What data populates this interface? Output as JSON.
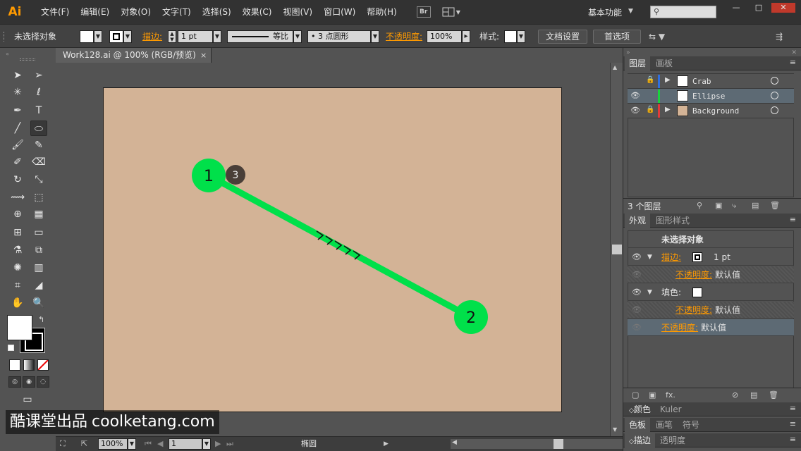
{
  "menubar": {
    "logo": "Ai",
    "items": [
      "文件(F)",
      "编辑(E)",
      "对象(O)",
      "文字(T)",
      "选择(S)",
      "效果(C)",
      "视图(V)",
      "窗口(W)",
      "帮助(H)"
    ],
    "bridge_label": "Br",
    "workspace": "基本功能",
    "window_controls": [
      "—",
      "□",
      "✕"
    ]
  },
  "controlbar": {
    "selection_label": "未选择对象",
    "stroke_label": "描边:",
    "stroke_weight": "1 pt",
    "stroke_profile": "等比",
    "brush_label": "3 点圆形",
    "opacity_label": "不透明度:",
    "opacity_value": "100%",
    "style_label": "样式:",
    "doc_setup_btn": "文档设置",
    "prefs_btn": "首选项"
  },
  "document": {
    "tab_title": "Work128.ai @ 100% (RGB/预览)",
    "tab_close": "×",
    "artboard_color": "#d3b396",
    "steps": [
      {
        "label": "1"
      },
      {
        "label": "3"
      },
      {
        "label": "2"
      }
    ],
    "path_color": "#00e04a",
    "step_marker_color": "#4a3f38"
  },
  "statusbar": {
    "zoom": "100%",
    "artboard_num": "1",
    "tool_name": "椭圆"
  },
  "layers_panel": {
    "tabs": [
      "图层",
      "画板"
    ],
    "layers": [
      {
        "name": "Crab",
        "color": "#2f6fe0",
        "locked": true,
        "visible": false,
        "expandable": true
      },
      {
        "name": "Ellipse",
        "color": "#19d23c",
        "locked": false,
        "visible": true,
        "expandable": false,
        "selected": true
      },
      {
        "name": "Background",
        "color": "#e03a3a",
        "locked": true,
        "visible": true,
        "expandable": true
      }
    ],
    "footer_count": "3 个图层"
  },
  "appearance_panel": {
    "tabs": [
      "外观",
      "图形样式"
    ],
    "header": "未选择对象",
    "stroke_label": "描边:",
    "stroke_value": "1 pt",
    "stroke_opacity_label": "不透明度:",
    "stroke_opacity_value": "默认值",
    "fill_label": "填色:",
    "fill_opacity_label": "不透明度:",
    "fill_opacity_value": "默认值",
    "opacity_label": "不透明度:",
    "opacity_value": "默认值",
    "fx_label": "fx."
  },
  "collapsed_panels": [
    {
      "tabs": [
        "颜色",
        "Kuler"
      ]
    },
    {
      "tabs": [
        "色板",
        "画笔",
        "符号"
      ]
    },
    {
      "tabs": [
        "描边",
        "透明度"
      ]
    }
  ],
  "watermark": {
    "text_cn": "酷课堂出品",
    "text_url": "coolketang.com"
  }
}
